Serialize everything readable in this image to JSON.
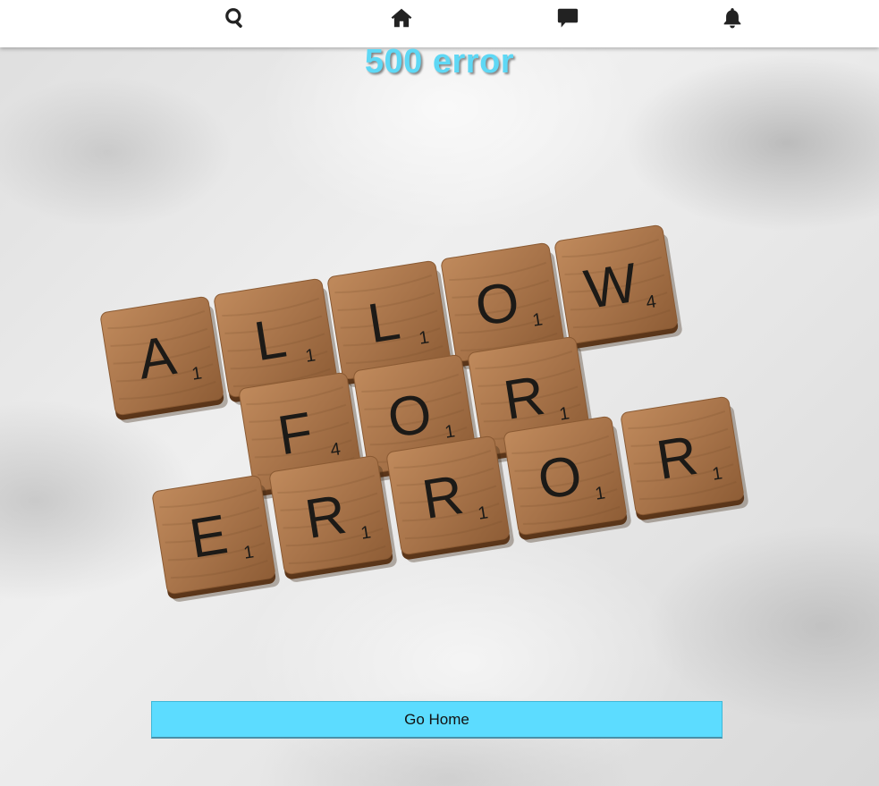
{
  "nav": {
    "items": [
      {
        "icon": "search-icon",
        "label": "Search"
      },
      {
        "icon": "home-icon",
        "label": "Home"
      },
      {
        "icon": "message-icon",
        "label": "Messages"
      },
      {
        "icon": "bell-icon",
        "label": "Notifications"
      }
    ]
  },
  "page": {
    "title": "500 error",
    "title_color": "#5ed8f5"
  },
  "illustration": {
    "rows": [
      [
        {
          "letter": "A",
          "score": "1"
        },
        {
          "letter": "L",
          "score": "1"
        },
        {
          "letter": "L",
          "score": "1"
        },
        {
          "letter": "O",
          "score": "1"
        },
        {
          "letter": "W",
          "score": "4"
        }
      ],
      [
        {
          "letter": "F",
          "score": "4"
        },
        {
          "letter": "O",
          "score": "1"
        },
        {
          "letter": "R",
          "score": "1"
        }
      ],
      [
        {
          "letter": "E",
          "score": "1"
        },
        {
          "letter": "R",
          "score": "1"
        },
        {
          "letter": "R",
          "score": "1"
        },
        {
          "letter": "O",
          "score": "1"
        },
        {
          "letter": "R",
          "score": "1"
        }
      ]
    ]
  },
  "actions": {
    "go_home_label": "Go Home",
    "go_home_color": "#5cdcff"
  }
}
